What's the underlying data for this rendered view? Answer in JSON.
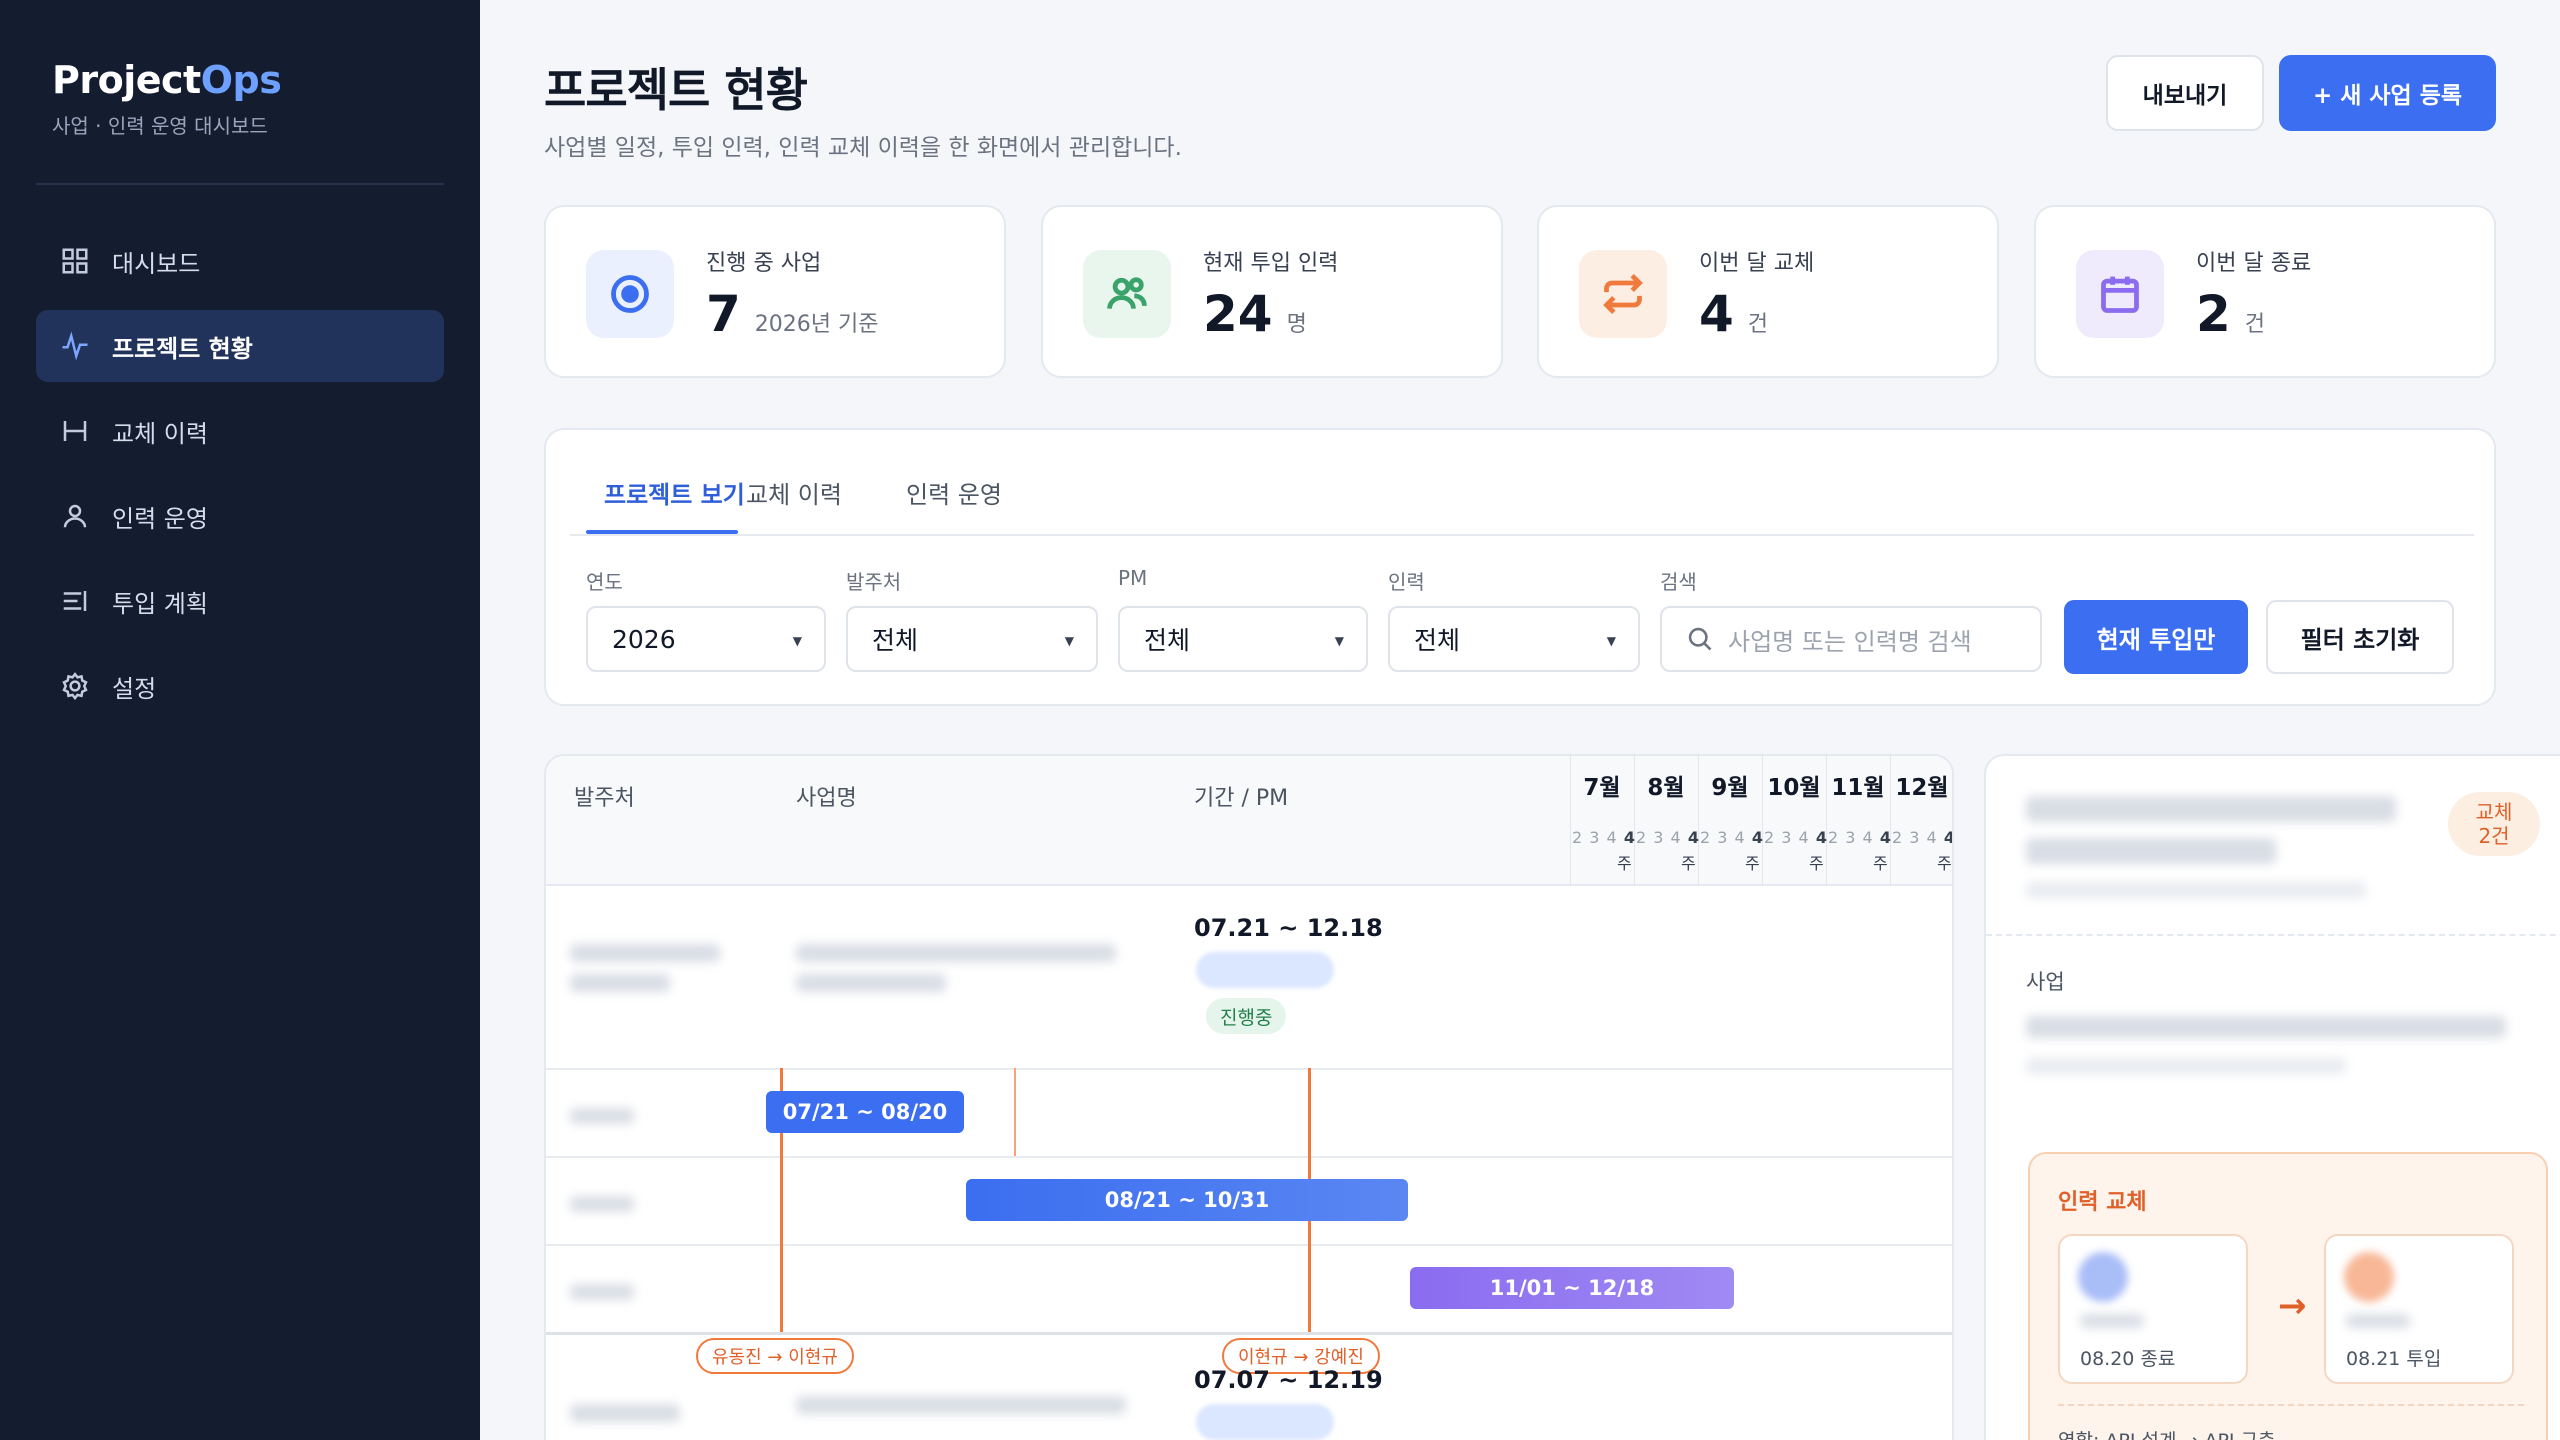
{
  "brand": {
    "name_main": "Project",
    "name_accent": "Ops",
    "subtitle": "사업 · 인력 운영 대시보드"
  },
  "nav": [
    {
      "label": "대시보드",
      "icon": "grid-icon",
      "active": false
    },
    {
      "label": "프로젝트 현황",
      "icon": "activity-icon",
      "active": true
    },
    {
      "label": "교체 이력",
      "icon": "swap-history-icon",
      "active": false
    },
    {
      "label": "인력 운영",
      "icon": "user-icon",
      "active": false
    },
    {
      "label": "투입 계획",
      "icon": "list-icon",
      "active": false
    },
    {
      "label": "설정",
      "icon": "gear-icon",
      "active": false
    }
  ],
  "header": {
    "title": "프로젝트 현황",
    "subtitle": "사업별 일정, 투입 인력, 인력 교체 이력을 한 화면에서 관리합니다.",
    "export_label": "내보내기",
    "new_label": "+ 새 사업 등록"
  },
  "stats": [
    {
      "label": "진행 중 사업",
      "value": "7",
      "unit": "2026년 기준",
      "icon": "target-icon",
      "color": "#3b6ef0",
      "bg": "#eaf0fe"
    },
    {
      "label": "현재 투입 인력",
      "value": "24",
      "unit": "명",
      "icon": "users-icon",
      "color": "#3aa36a",
      "bg": "#e8f6ee"
    },
    {
      "label": "이번 달 교체",
      "value": "4",
      "unit": "건",
      "icon": "swap-icon",
      "color": "#f07a3c",
      "bg": "#fdeee4"
    },
    {
      "label": "이번 달 종료",
      "value": "2",
      "unit": "건",
      "icon": "calendar-icon",
      "color": "#8b6cf0",
      "bg": "#efebfd"
    }
  ],
  "tabs": [
    {
      "label": "프로젝트 보기",
      "active": true
    },
    {
      "label": "교체 이력",
      "active": false
    },
    {
      "label": "인력 운영",
      "active": false
    }
  ],
  "filters": {
    "year": {
      "label": "연도",
      "value": "2026"
    },
    "client": {
      "label": "발주처",
      "value": "전체"
    },
    "pm": {
      "label": "PM",
      "value": "전체"
    },
    "staff": {
      "label": "인력",
      "value": "전체"
    },
    "search": {
      "label": "검색",
      "placeholder": "사업명 또는 인력명 검색"
    },
    "current_only_label": "현재 투입만",
    "reset_label": "필터 초기화"
  },
  "gantt": {
    "columns": {
      "client": "발주처",
      "project": "사업명",
      "period_pm": "기간 / PM"
    },
    "months": [
      "7월",
      "8월",
      "9월",
      "10월",
      "11월",
      "12월"
    ],
    "week_small": "2 3 4",
    "week_bold": "4",
    "week_suffix": "주",
    "project1": {
      "period": "07.21 ~ 12.18",
      "status": "진행중"
    },
    "bars": [
      {
        "label": "07/21 ~ 08/20",
        "color": "#3b6ef0"
      },
      {
        "label": "08/21 ~ 10/31",
        "color": "#4a7bf0"
      },
      {
        "label": "11/01 ~ 12/18",
        "color": "#8a6cf0"
      }
    ],
    "swaps": [
      "유동진 → 이현규",
      "이현규 → 강예진"
    ],
    "project2": {
      "period": "07.07 ~ 12.19"
    }
  },
  "detail": {
    "swap_count": "교체\n2건",
    "swap_count_line1": "교체",
    "swap_count_line2": "2건",
    "section_label": "사업",
    "swap_title": "인력 교체",
    "from_note": "08.20 종료",
    "to_note": "08.21 투입",
    "role": "역할: API 설계 → API 구축"
  }
}
